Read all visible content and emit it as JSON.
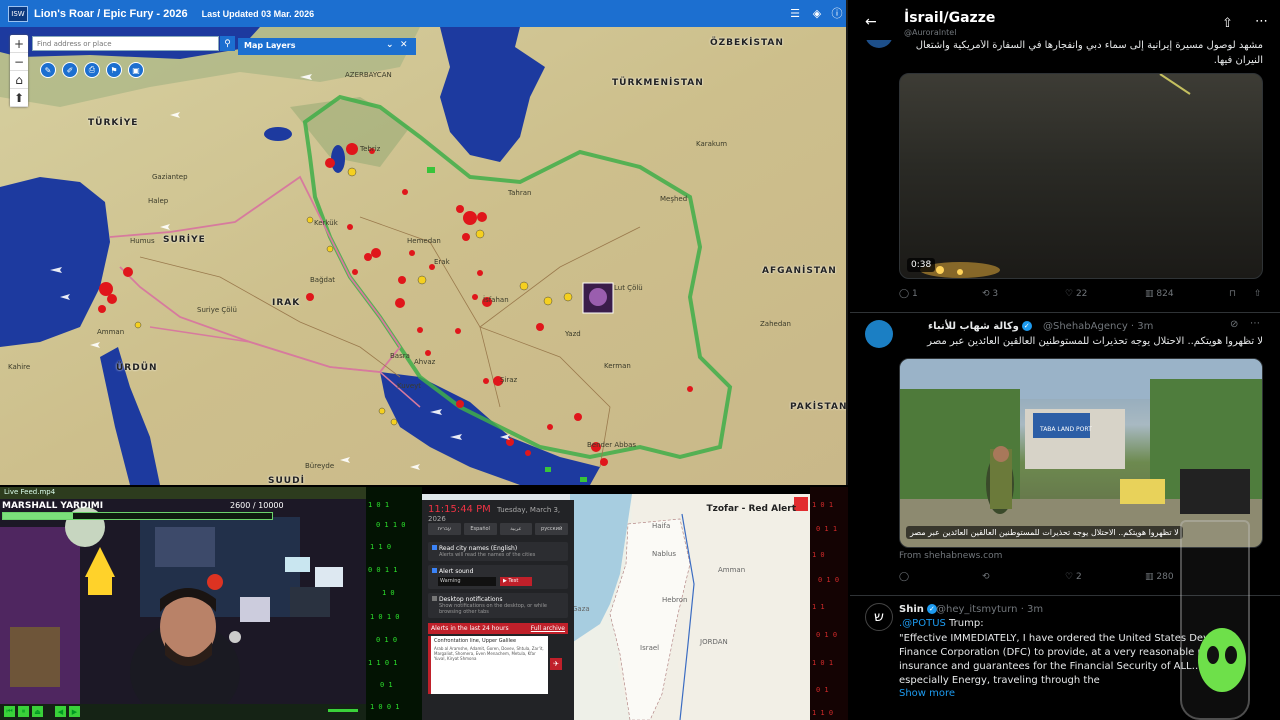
{
  "map": {
    "title": "Lion's Roar / Epic Fury - 2026",
    "updated": "Last Updated 03 Mar. 2026",
    "logo": "ISW",
    "search_placeholder": "Find address or place",
    "layers_label": "Map Layers",
    "places": [
      {
        "name": "ÖZBEKİSTAN",
        "kind": "country"
      },
      {
        "name": "TÜRKMENİSTAN",
        "kind": "country"
      },
      {
        "name": "TÜRKİYE",
        "kind": "country"
      },
      {
        "name": "SURİYE",
        "kind": "country"
      },
      {
        "name": "IRAK",
        "kind": "country"
      },
      {
        "name": "AFGANİSTAN",
        "kind": "country"
      },
      {
        "name": "PAKİSTAN",
        "kind": "country"
      },
      {
        "name": "ÜRDÜN",
        "kind": "country"
      },
      {
        "name": "SUUDİ",
        "kind": "country"
      },
      {
        "name": "AZERBAYCAN",
        "kind": "place"
      },
      {
        "name": "Tebriz",
        "kind": "place"
      },
      {
        "name": "Kerkük",
        "kind": "place"
      },
      {
        "name": "Bağdat",
        "kind": "place"
      },
      {
        "name": "Halep",
        "kind": "place"
      },
      {
        "name": "Hemedan",
        "kind": "place"
      },
      {
        "name": "Erak",
        "kind": "place"
      },
      {
        "name": "İsfahan",
        "kind": "place"
      },
      {
        "name": "Ahvaz",
        "kind": "place"
      },
      {
        "name": "Basra",
        "kind": "place"
      },
      {
        "name": "Kuveyt",
        "kind": "place"
      },
      {
        "name": "Şiraz",
        "kind": "place"
      },
      {
        "name": "Yazd",
        "kind": "place"
      },
      {
        "name": "Kerman",
        "kind": "place"
      },
      {
        "name": "Bender Abbas",
        "kind": "place"
      },
      {
        "name": "Meşhed",
        "kind": "place"
      },
      {
        "name": "Karakum",
        "kind": "place"
      },
      {
        "name": "Lut Çölü",
        "kind": "place"
      },
      {
        "name": "Suriye Çölü",
        "kind": "place"
      },
      {
        "name": "Amman",
        "kind": "place"
      },
      {
        "name": "Gaziantep",
        "kind": "place"
      },
      {
        "name": "Kahire",
        "kind": "place"
      },
      {
        "name": "Büreyde",
        "kind": "place"
      },
      {
        "name": "Zahedan",
        "kind": "place"
      },
      {
        "name": "Humus",
        "kind": "place"
      },
      {
        "name": "Tahran",
        "kind": "place"
      }
    ],
    "colors": {
      "title_bar": "#1c6fd0",
      "strike": "#e0161b",
      "water": "#1d3a9f",
      "land": "#cfc79a"
    }
  },
  "webcam": {
    "header": "Live Feed.mp4",
    "name": "MARSHALL YARDIMI",
    "score": "2600",
    "score_max": "/ 10000",
    "hp_fraction": 0.26
  },
  "alert_app": {
    "clock": "11:15:44 PM",
    "date": "Tuesday, March 3, 2026",
    "languages": [
      "עברית",
      "Español",
      "عربية",
      "русский"
    ],
    "read_names": "Read city names (English)",
    "read_names_desc": "Alerts will read the names of the cities",
    "alert_sound": "Alert sound",
    "sound_value": "Warning",
    "test_label": "▶ Test",
    "desktop_notif": "Desktop notifications",
    "desktop_desc": "Show notifications on the desktop, or while browsing other tabs",
    "last24": "Alerts in the last 24 hours",
    "archive": "Full archive",
    "alert_type": "Confrontation line, Upper Galilee",
    "alert_area": "Arab al Aramshe, Adamit, Goren, Dovev, Shtula, Zar'it, Margaliot, Shomera, Even Menachem, Metula, Kfar Yuval, Kiryat Shmona",
    "map_title": "Tzofar - Red Alert",
    "map_labels": [
      "Amman",
      "Israel",
      "Gaza",
      "ISRAEL",
      "JORDAN",
      "Haifa",
      "Nablus",
      "Hebron"
    ]
  },
  "x": {
    "title": "İsrail/Gazze",
    "post1": {
      "handle": "@AuroraIntel",
      "text": "مشهد لوصول مسيرة إيرانية إلى سماء دبي وانفجارها في السفارة الأمريكية واشتعال النيران فيها.",
      "video_time": "0:38",
      "replies": "1",
      "reposts": "3",
      "likes": "22",
      "views": "824"
    },
    "post2": {
      "name": "وكالة شهاب للأنباء",
      "handle": "@ShehabAgency · 3m",
      "text": "لا تظهروا هويتكم.. الاحتلال يوجه تحذيرات للمستوطنين العالقين العائدين عبر مصر",
      "caption": "لا تظهروا هويتكم.. الاحتلال يوجه تحذيرات للمستوطنين العالقين العائدين عبر مصر",
      "source": "From shehabnews.com",
      "sign": "TABA LAND PORT",
      "replies": "",
      "reposts": "",
      "likes": "2",
      "views": "280"
    },
    "post3": {
      "name": "Shin",
      "handle": "@hey_itsmyturn · 3m",
      "mention": ".@POTUS",
      "text_head": " Trump:",
      "text": "\"Effective IMMEDIATELY, I have ordered the United States Dev… Finance Corporation (DFC) to provide, at a very reasonable pri… risk insurance and guarantees for the Financial Security of ALL… Trade, especially Energy, traveling through the",
      "show_more": "Show more"
    }
  }
}
